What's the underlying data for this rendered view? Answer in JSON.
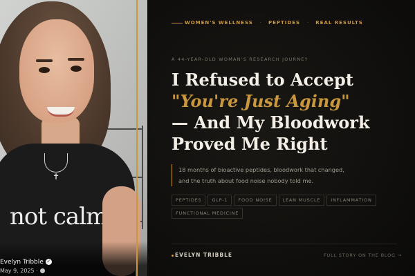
{
  "photo": {
    "shirt_text": "not calm",
    "poster_name": "Evelyn Tribble",
    "poster_date": "May 9, 2025 ·",
    "verified_icon": "check-badge-icon",
    "privacy_icon": "globe-icon"
  },
  "colors": {
    "accent_gold": "#c9973e",
    "background": "#0d0c0b",
    "headline_text": "#f4efe6"
  },
  "nav": {
    "items": [
      "WOMEN'S WELLNESS",
      "PEPTIDES",
      "REAL RESULTS"
    ],
    "separator": "·"
  },
  "article": {
    "eyebrow": "A 44-YEAR-OLD WOMAN'S RESEARCH JOURNEY",
    "headline_line1": "I Refused to Accept",
    "headline_accent": "\"You're Just Aging\"",
    "headline_line3": "— And My Bloodwork",
    "headline_line4": "Proved Me Right",
    "summary_line1": "18 months of bioactive peptides, bloodwork that changed,",
    "summary_line2": "and the truth about food noise nobody told me.",
    "tags": [
      "PEPTIDES",
      "GLP-1",
      "FOOD NOISE",
      "LEAN MUSCLE",
      "INFLAMMATION",
      "FUNCTIONAL MEDICINE"
    ]
  },
  "footer": {
    "author": "EVELYN TRIBBLE",
    "cta": "FULL STORY ON THE BLOG →"
  }
}
